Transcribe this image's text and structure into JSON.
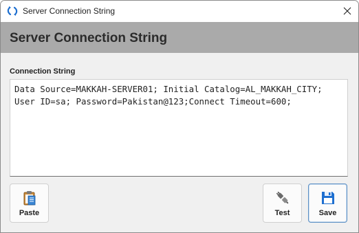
{
  "window": {
    "title": "Server Connection String",
    "app_icon": "refresh-icon",
    "close_icon": "close-icon"
  },
  "header": {
    "title": "Server Connection String"
  },
  "form": {
    "label": "Connection String",
    "value": "Data Source=MAKKAH-SERVER01; Initial Catalog=AL_MAKKAH_CITY;\nUser ID=sa; Password=Pakistan@123;Connect Timeout=600;"
  },
  "buttons": {
    "paste": {
      "label": "Paste",
      "icon": "clipboard-icon"
    },
    "test": {
      "label": "Test",
      "icon": "plug-icon"
    },
    "save": {
      "label": "Save",
      "icon": "floppy-disk-icon"
    }
  },
  "colors": {
    "header_band": "#aaaaaa",
    "window_bg": "#f0f0f0",
    "accent": "#1e6fd0",
    "primary_button_border": "#5a8ec4"
  }
}
